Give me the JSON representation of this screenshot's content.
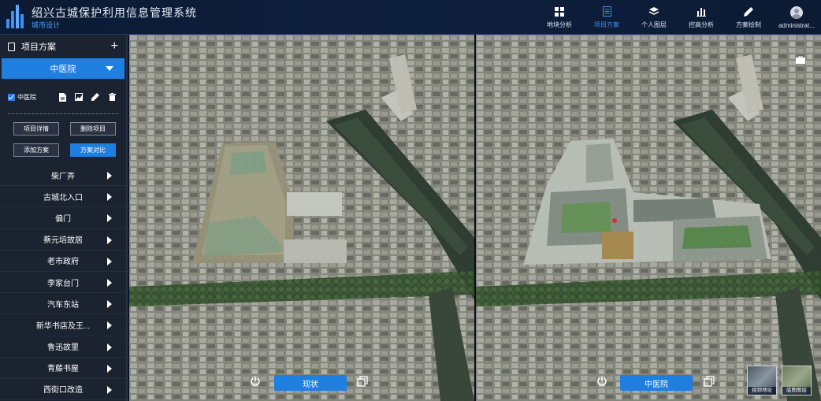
{
  "app": {
    "title": "绍兴古城保护利用信息管理系统",
    "subtitle": "城市设计"
  },
  "nav": [
    {
      "label": "地块分析",
      "icon": "grid-blocks-icon",
      "active": false
    },
    {
      "label": "项目方案",
      "icon": "document-icon",
      "active": true
    },
    {
      "label": "个人图层",
      "icon": "layers-icon",
      "active": false
    },
    {
      "label": "控高分析",
      "icon": "bar-chart-icon",
      "active": false
    },
    {
      "label": "方案绘制",
      "icon": "pen-icon",
      "active": false
    }
  ],
  "user": {
    "name": "administrat..."
  },
  "sidebar": {
    "header": "项目方案",
    "selected_project": "中医院",
    "checkbox_label": "中医院",
    "buttons": {
      "details": "项目详情",
      "delete": "删除项目",
      "add": "添加方案",
      "compare": "方案对比"
    },
    "items": [
      {
        "label": "柴厂弄"
      },
      {
        "label": "古城北入口"
      },
      {
        "label": "偏门"
      },
      {
        "label": "蔡元培故居"
      },
      {
        "label": "老市政府"
      },
      {
        "label": "李家台门"
      },
      {
        "label": "汽车东站"
      },
      {
        "label": "新华书店及王..."
      },
      {
        "label": "鲁迅故里"
      },
      {
        "label": "青藤书屋"
      },
      {
        "label": "西街口改造"
      }
    ]
  },
  "views": {
    "left_label": "现状",
    "right_label": "中医院"
  },
  "layers": {
    "video_label": "视频地址",
    "base_label": "底图图层"
  },
  "colors": {
    "accent": "#1f7fe0",
    "header_bg": "#0c1a33",
    "sidebar_bg": "#1b2230"
  }
}
